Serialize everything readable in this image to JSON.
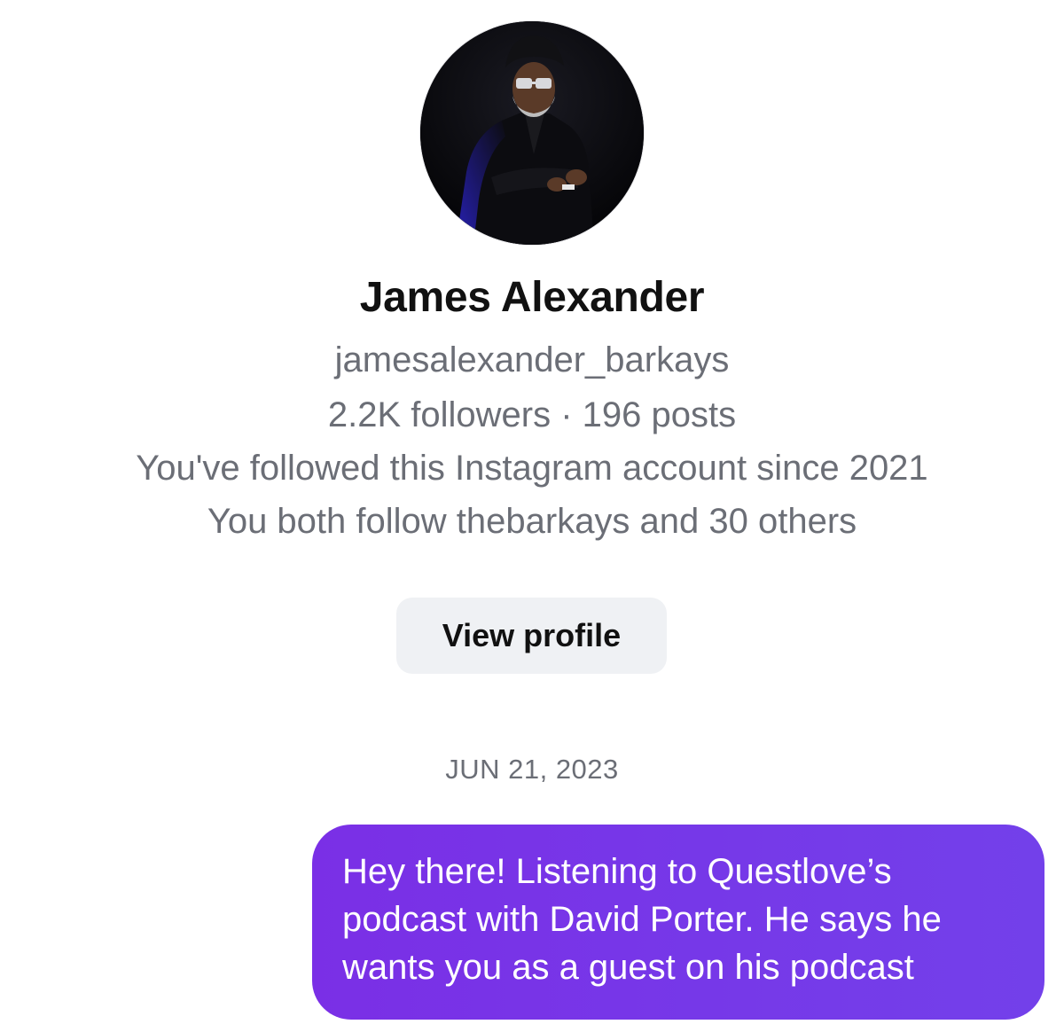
{
  "profile": {
    "name": "James Alexander",
    "handle": "jamesalexander_barkays",
    "stats": "2.2K followers · 196 posts",
    "followed_since": "You've followed this Instagram account since 2021",
    "mutual": "You both follow thebarkays and 30 others",
    "view_profile_label": "View profile",
    "avatar_icon": "profile-photo"
  },
  "thread": {
    "date": "JUN 21, 2023",
    "messages": [
      {
        "text": "Hey there! Listening to Questlove’s podcast with David Porter. He says he wants you as a guest on his podcast"
      }
    ]
  },
  "colors": {
    "bubble": "#7a2fe6",
    "secondary_text": "#6b6e76",
    "button_bg": "#eff1f4"
  }
}
